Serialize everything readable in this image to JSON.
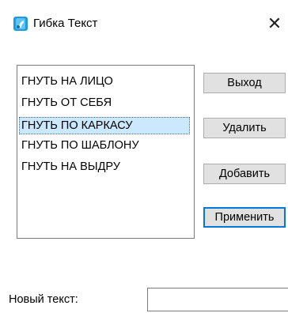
{
  "window": {
    "title": "Гибка Текст",
    "close_glyph": "✕",
    "icon": "app-icon",
    "icon_color": "#1e9be0"
  },
  "list": {
    "items": [
      {
        "label": "ГНУТЬ НА ЛИЦО",
        "selected": false
      },
      {
        "label": "ГНУТЬ ОТ СЕБЯ",
        "selected": false
      },
      {
        "label": "ГНУТЬ ПО КАРКАСУ",
        "selected": true
      },
      {
        "label": "ГНУТЬ ПО ШАБЛОНУ",
        "selected": false
      },
      {
        "label": "ГНУТЬ НА ВЫДРУ",
        "selected": false
      }
    ],
    "selection_color": "#cce8ff"
  },
  "buttons": {
    "exit": "Выход",
    "delete": "Удалить",
    "add": "Добавить",
    "apply": "Применить"
  },
  "new_text": {
    "label": "Новый текст:",
    "value": ""
  }
}
